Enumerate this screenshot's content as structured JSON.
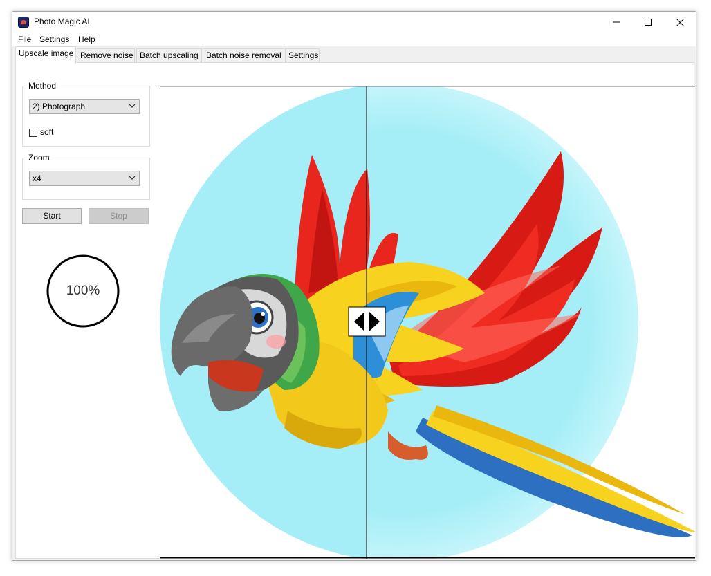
{
  "window": {
    "title": "Photo Magic AI",
    "controls": [
      "minimize",
      "maximize",
      "close"
    ]
  },
  "menu": [
    "File",
    "Settings",
    "Help"
  ],
  "tabs": [
    {
      "label": "Upscale image",
      "active": true
    },
    {
      "label": "Remove noise",
      "active": false
    },
    {
      "label": "Batch upscaling",
      "active": false
    },
    {
      "label": "Batch noise removal",
      "active": false
    },
    {
      "label": "Settings",
      "active": false
    }
  ],
  "method": {
    "legend": "Method",
    "selected": "2) Photograph",
    "soft_label": "soft",
    "soft_checked": false
  },
  "zoom": {
    "legend": "Zoom",
    "selected": "x4"
  },
  "buttons": {
    "start": "Start",
    "stop": "Stop",
    "stop_enabled": false
  },
  "progress": {
    "value": 100,
    "label": "100%"
  },
  "preview": {
    "comparison": "before-after split slider",
    "split_fraction": 0.387,
    "background_circle_color": "#a6eef7",
    "parrot_colors": [
      "#e8261e",
      "#f7d21e",
      "#2d8fd8",
      "#5a5a5a",
      "#3fa64a"
    ]
  },
  "icons": {
    "app": "photo-magic-ai-app-icon",
    "split_handle": "left-right-arrows-icon",
    "dropdown": "chevron-down-icon"
  }
}
